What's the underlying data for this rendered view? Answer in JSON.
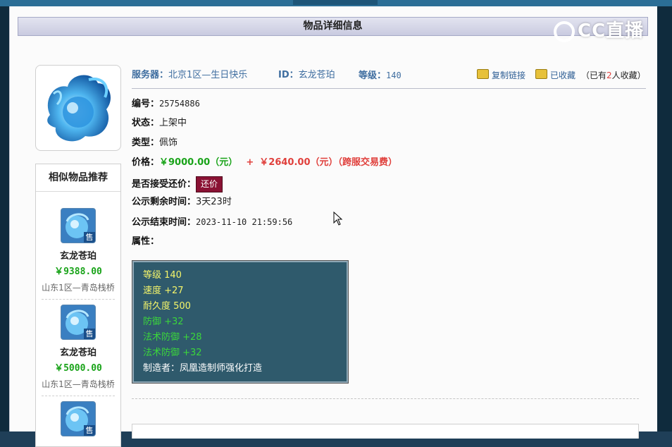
{
  "header": {
    "title": "物品详细信息"
  },
  "watermark": {
    "text": "CC直播"
  },
  "item": {
    "server_label": "服务器：",
    "server_value": "北京1区—生日快乐",
    "id_label": "ID：",
    "id_value": "玄龙苍珀",
    "level_label": "等级：",
    "level_value": "140"
  },
  "actions": {
    "copy_link": "复制链接",
    "favorited": "已收藏",
    "fav_count_prefix": "（已有",
    "fav_count": "2",
    "fav_count_suffix": "人收藏）"
  },
  "fields": {
    "number_label": "编号：",
    "number_value": "25754886",
    "status_label": "状态：",
    "status_value": "上架中",
    "type_label": "类型：",
    "type_value": "佩饰",
    "price_label": "价格：",
    "price_value": "￥9000.00（元）",
    "price_plus": "+",
    "fee_value": "￥2640.00（元）（跨服交易费）",
    "counter_label": "是否接受还价：",
    "counter_button": "还价",
    "remain_label": "公示剩余时间：",
    "remain_value": "3天23时",
    "end_label": "公示结束时间：",
    "end_value": "2023-11-10 21:59:56",
    "attr_label": "属性："
  },
  "attributes": [
    {
      "text": "等级 140",
      "color": "#f5f56a"
    },
    {
      "text": "速度 +27",
      "color": "#f5f56a"
    },
    {
      "text": "耐久度 500",
      "color": "#f5f56a"
    },
    {
      "text": "防御 +32",
      "color": "#3bd63b"
    },
    {
      "text": "法术防御 +28",
      "color": "#3bd63b"
    },
    {
      "text": "法术防御 +32",
      "color": "#3bd63b"
    },
    {
      "text": "制造者：凤凰造制师强化打造",
      "color": "#ffffff"
    }
  ],
  "similar": {
    "title": "相似物品推荐",
    "items": [
      {
        "name": "玄龙苍珀",
        "price": "￥9388.00",
        "server": "山东1区—青岛栈桥",
        "badge": "售"
      },
      {
        "name": "玄龙苍珀",
        "price": "￥5000.00",
        "server": "山东1区—青岛栈桥",
        "badge": "售"
      },
      {
        "badge": "售"
      }
    ]
  }
}
